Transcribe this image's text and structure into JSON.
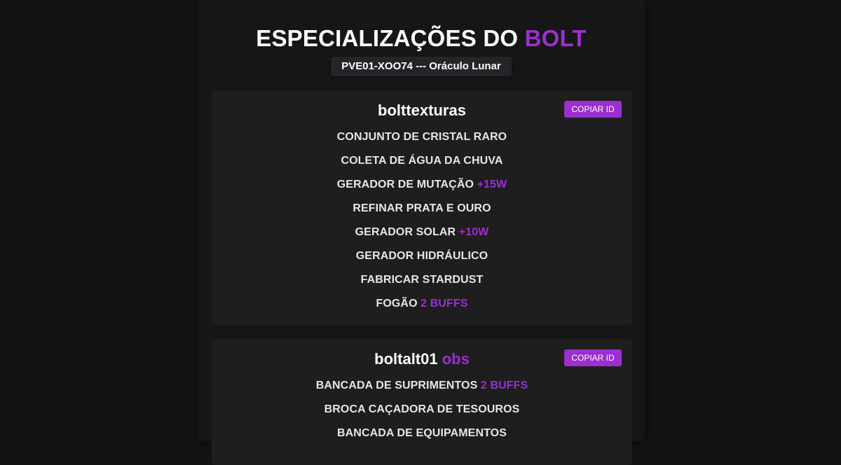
{
  "header": {
    "title_main": "ESPECIALIZAÇÕES DO ",
    "title_accent": "BOLT",
    "server_label": "PVE01-XOO74 --- Oráculo Lunar"
  },
  "colors": {
    "accent": "#9b2fd0",
    "background": "#131313",
    "card": "#1e1e1e"
  },
  "cards": [
    {
      "name": "bolttexturas",
      "name_suffix": "",
      "copy_label": "COPIAR ID",
      "items": [
        {
          "label": "CONJUNTO DE CRISTAL RARO",
          "extra": ""
        },
        {
          "label": "COLETA DE ÁGUA DA CHUVA",
          "extra": ""
        },
        {
          "label": "GERADOR DE MUTAÇÃO",
          "extra": "+15W"
        },
        {
          "label": "REFINAR PRATA E OURO",
          "extra": ""
        },
        {
          "label": "GERADOR SOLAR",
          "extra": "+10W"
        },
        {
          "label": "GERADOR HIDRÁULICO",
          "extra": ""
        },
        {
          "label": "FABRICAR STARDUST",
          "extra": ""
        },
        {
          "label": "FOGÃO",
          "extra": "2 BUFFS"
        }
      ]
    },
    {
      "name": "boltalt01",
      "name_suffix": "obs",
      "copy_label": "COPIAR ID",
      "items": [
        {
          "label": "BANCADA DE SUPRIMENTOS",
          "extra": "2 BUFFS"
        },
        {
          "label": "BROCA CAÇADORA DE TESOUROS",
          "extra": ""
        },
        {
          "label": "BANCADA DE EQUIPAMENTOS",
          "extra": ""
        }
      ]
    }
  ]
}
